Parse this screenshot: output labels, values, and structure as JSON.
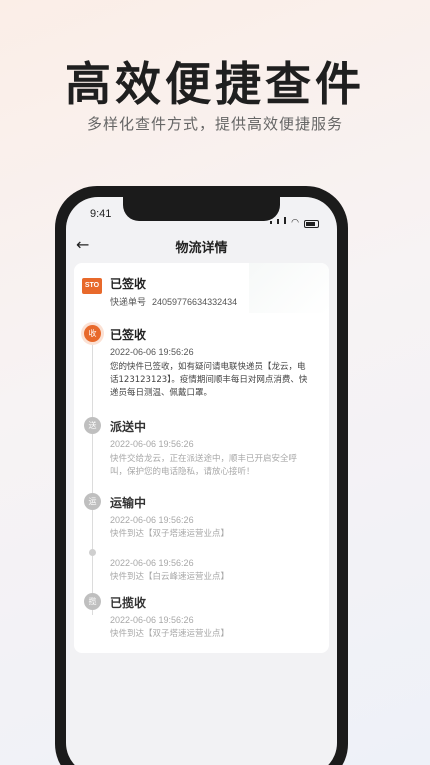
{
  "promo": {
    "headline": "高效便捷查件",
    "subheadline": "多样化查件方式，提供高效便捷服务"
  },
  "status_bar": {
    "time": "9:41"
  },
  "nav": {
    "title": "物流详情"
  },
  "shipment": {
    "courier_logo_text": "STO",
    "status": "已签收",
    "tracking_label": "快递单号",
    "tracking_number": "24059776634332434"
  },
  "timeline": [
    {
      "title": "已签收",
      "icon_char": "收",
      "time": "2022-06-06 19:56:26",
      "desc": "您的快件已签收，如有疑问请电联快递员【龙云，电话123123123】。疫情期间顺丰每日对网点消费、快递员每日测温、佩戴口罩。",
      "active": true
    },
    {
      "title": "派送中",
      "icon_char": "送",
      "time": "2022-06-06 19:56:26",
      "desc": "快件交给龙云，正在派送途中，顺丰已开启安全呼叫，保护您的电话隐私，请放心接听！",
      "active": false
    },
    {
      "title": "运输中",
      "icon_char": "运",
      "time": "2022-06-06 19:56:26",
      "desc": "快件到达【双子塔速运营业点】",
      "active": false
    },
    {
      "title": "",
      "icon_char": "",
      "time": "2022-06-06 19:56:26",
      "desc": "快件到达【白云峰速运营业点】",
      "active": false
    },
    {
      "title": "已揽收",
      "icon_char": "揽",
      "time": "2022-06-06 19:56:26",
      "desc": "快件到达【双子塔速运营业点】",
      "active": false
    }
  ],
  "colors": {
    "accent": "#e8692b",
    "inactive_icon": "#bfbfbf"
  },
  "icons": {
    "back": "back-arrow-icon",
    "signal": "signal-icon",
    "wifi": "wifi-icon",
    "battery": "battery-icon"
  }
}
